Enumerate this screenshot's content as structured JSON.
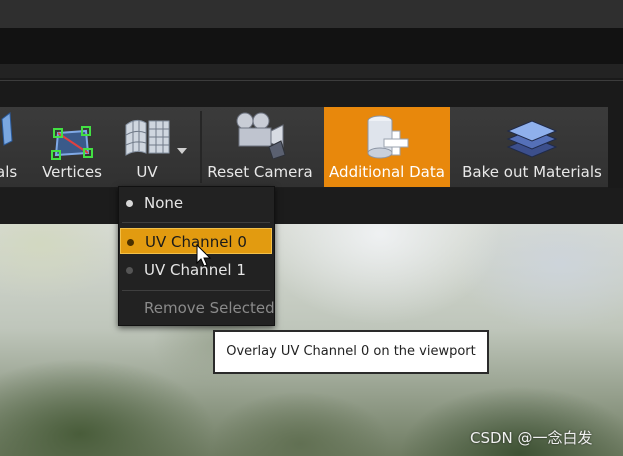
{
  "toolbar": {
    "items": [
      {
        "label": "als",
        "icon": "materials-icon"
      },
      {
        "label": "Vertices",
        "icon": "vertices-icon"
      },
      {
        "label": "UV",
        "icon": "uv-grid-icon"
      },
      {
        "label": "Reset Camera",
        "icon": "camera-icon"
      },
      {
        "label": "Additional Data",
        "icon": "additional-data-icon",
        "active": true
      },
      {
        "label": "Bake out Materials",
        "icon": "layers-icon"
      }
    ]
  },
  "uv_menu": {
    "items": [
      {
        "label": "None",
        "state": "normal"
      },
      {
        "label": "UV Channel 0",
        "state": "selected"
      },
      {
        "label": "UV Channel 1",
        "state": "normal"
      },
      {
        "label": "Remove Selected",
        "state": "disabled"
      }
    ]
  },
  "tooltip": {
    "text": "Overlay UV Channel 0 on the viewport"
  },
  "watermark": {
    "text": "CSDN @一念白发"
  },
  "colors": {
    "accent": "#e8880c",
    "menu_selected": "#e29b10"
  }
}
